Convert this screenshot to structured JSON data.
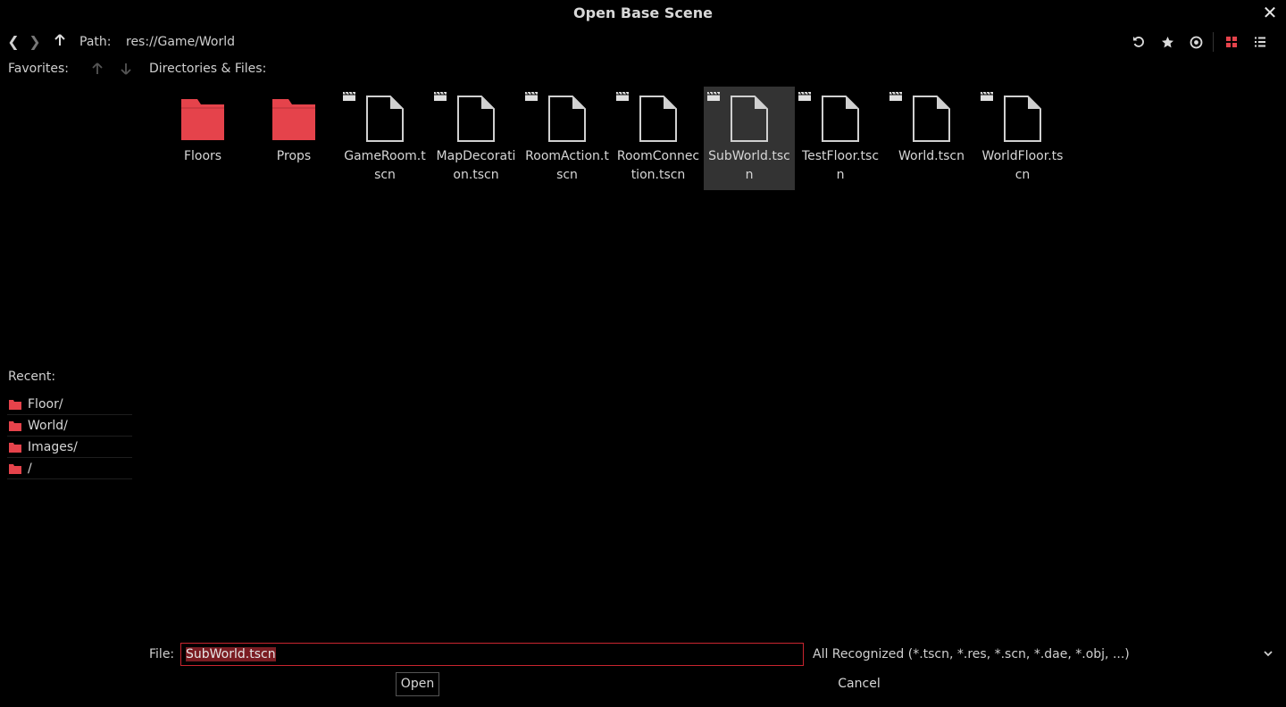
{
  "window": {
    "title": "Open Base Scene",
    "close_icon": "close-icon"
  },
  "toolbar": {
    "back_icon": "back-icon",
    "forward_icon": "forward-icon",
    "up_icon": "up-arrow-icon",
    "path_label": "Path:",
    "path_value": "res://Game/World",
    "right_icons": [
      "refresh-icon",
      "favorite-star-icon",
      "show-hidden-eye-icon",
      "grid-view-icon",
      "list-view-icon"
    ]
  },
  "favorites": {
    "label": "Favorites:"
  },
  "directories": {
    "label": "Directories & Files:",
    "items": [
      {
        "name": "Floors",
        "type": "folder",
        "selected": false
      },
      {
        "name": "Props",
        "type": "folder",
        "selected": false
      },
      {
        "name": "GameRoom.tscn",
        "type": "scene",
        "selected": false
      },
      {
        "name": "MapDecoration.tscn",
        "type": "scene",
        "selected": false
      },
      {
        "name": "RoomAction.tscn",
        "type": "scene",
        "selected": false
      },
      {
        "name": "RoomConnection.tscn",
        "type": "scene",
        "selected": false
      },
      {
        "name": "SubWorld.tscn",
        "type": "scene",
        "selected": true
      },
      {
        "name": "TestFloor.tscn",
        "type": "scene",
        "selected": false
      },
      {
        "name": "World.tscn",
        "type": "scene",
        "selected": false
      },
      {
        "name": "WorldFloor.tscn",
        "type": "scene",
        "selected": false
      }
    ]
  },
  "recent": {
    "label": "Recent:",
    "items": [
      "Floor/",
      "World/",
      "Images/",
      "/"
    ]
  },
  "footer": {
    "file_label": "File:",
    "file_value": "SubWorld.tscn",
    "filter": "All Recognized (*.tscn, *.res, *.scn, *.dae, *.obj, ...)",
    "open_label": "Open",
    "cancel_label": "Cancel"
  },
  "colors": {
    "accent": "#e5434b",
    "selection": "#333333",
    "input_border": "#c9252f"
  }
}
